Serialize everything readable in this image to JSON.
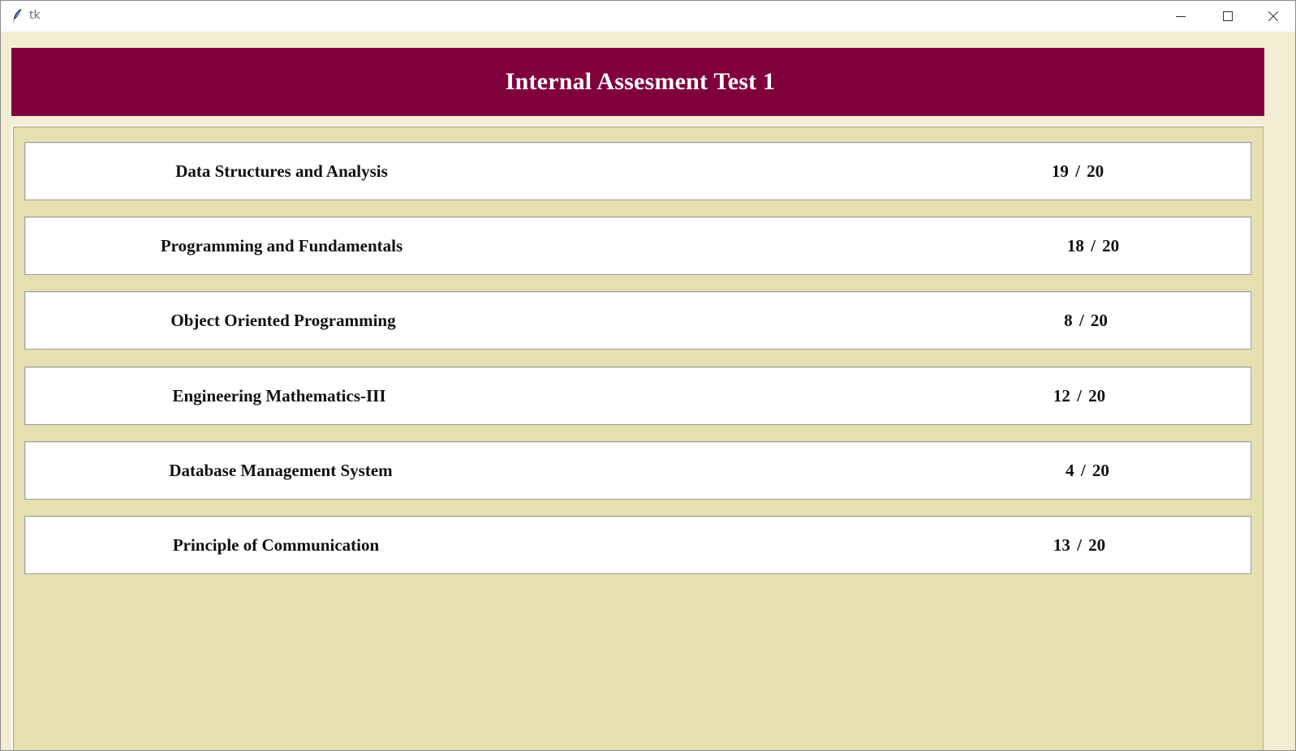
{
  "window": {
    "title": "tk"
  },
  "header": {
    "title": "Internal Assesment Test 1"
  },
  "results": [
    {
      "subject": "Data Structures and Analysis",
      "score": "19 / 20"
    },
    {
      "subject": "Programming and Fundamentals",
      "score": "18 / 20"
    },
    {
      "subject": "Object Oriented Programming",
      "score": "8 / 20"
    },
    {
      "subject": "Engineering Mathematics-III",
      "score": "12 / 20"
    },
    {
      "subject": "Database Management System",
      "score": "4 / 20"
    },
    {
      "subject": "Principle of Communication",
      "score": "13 / 20"
    }
  ],
  "colors": {
    "header_bg": "#80003c",
    "panel_bg": "#e6dfb0",
    "window_bg": "#f3eed3"
  },
  "icons": {
    "app": "tk-feather-icon",
    "minimize": "minimize-icon",
    "maximize": "maximize-icon",
    "close": "close-icon"
  }
}
